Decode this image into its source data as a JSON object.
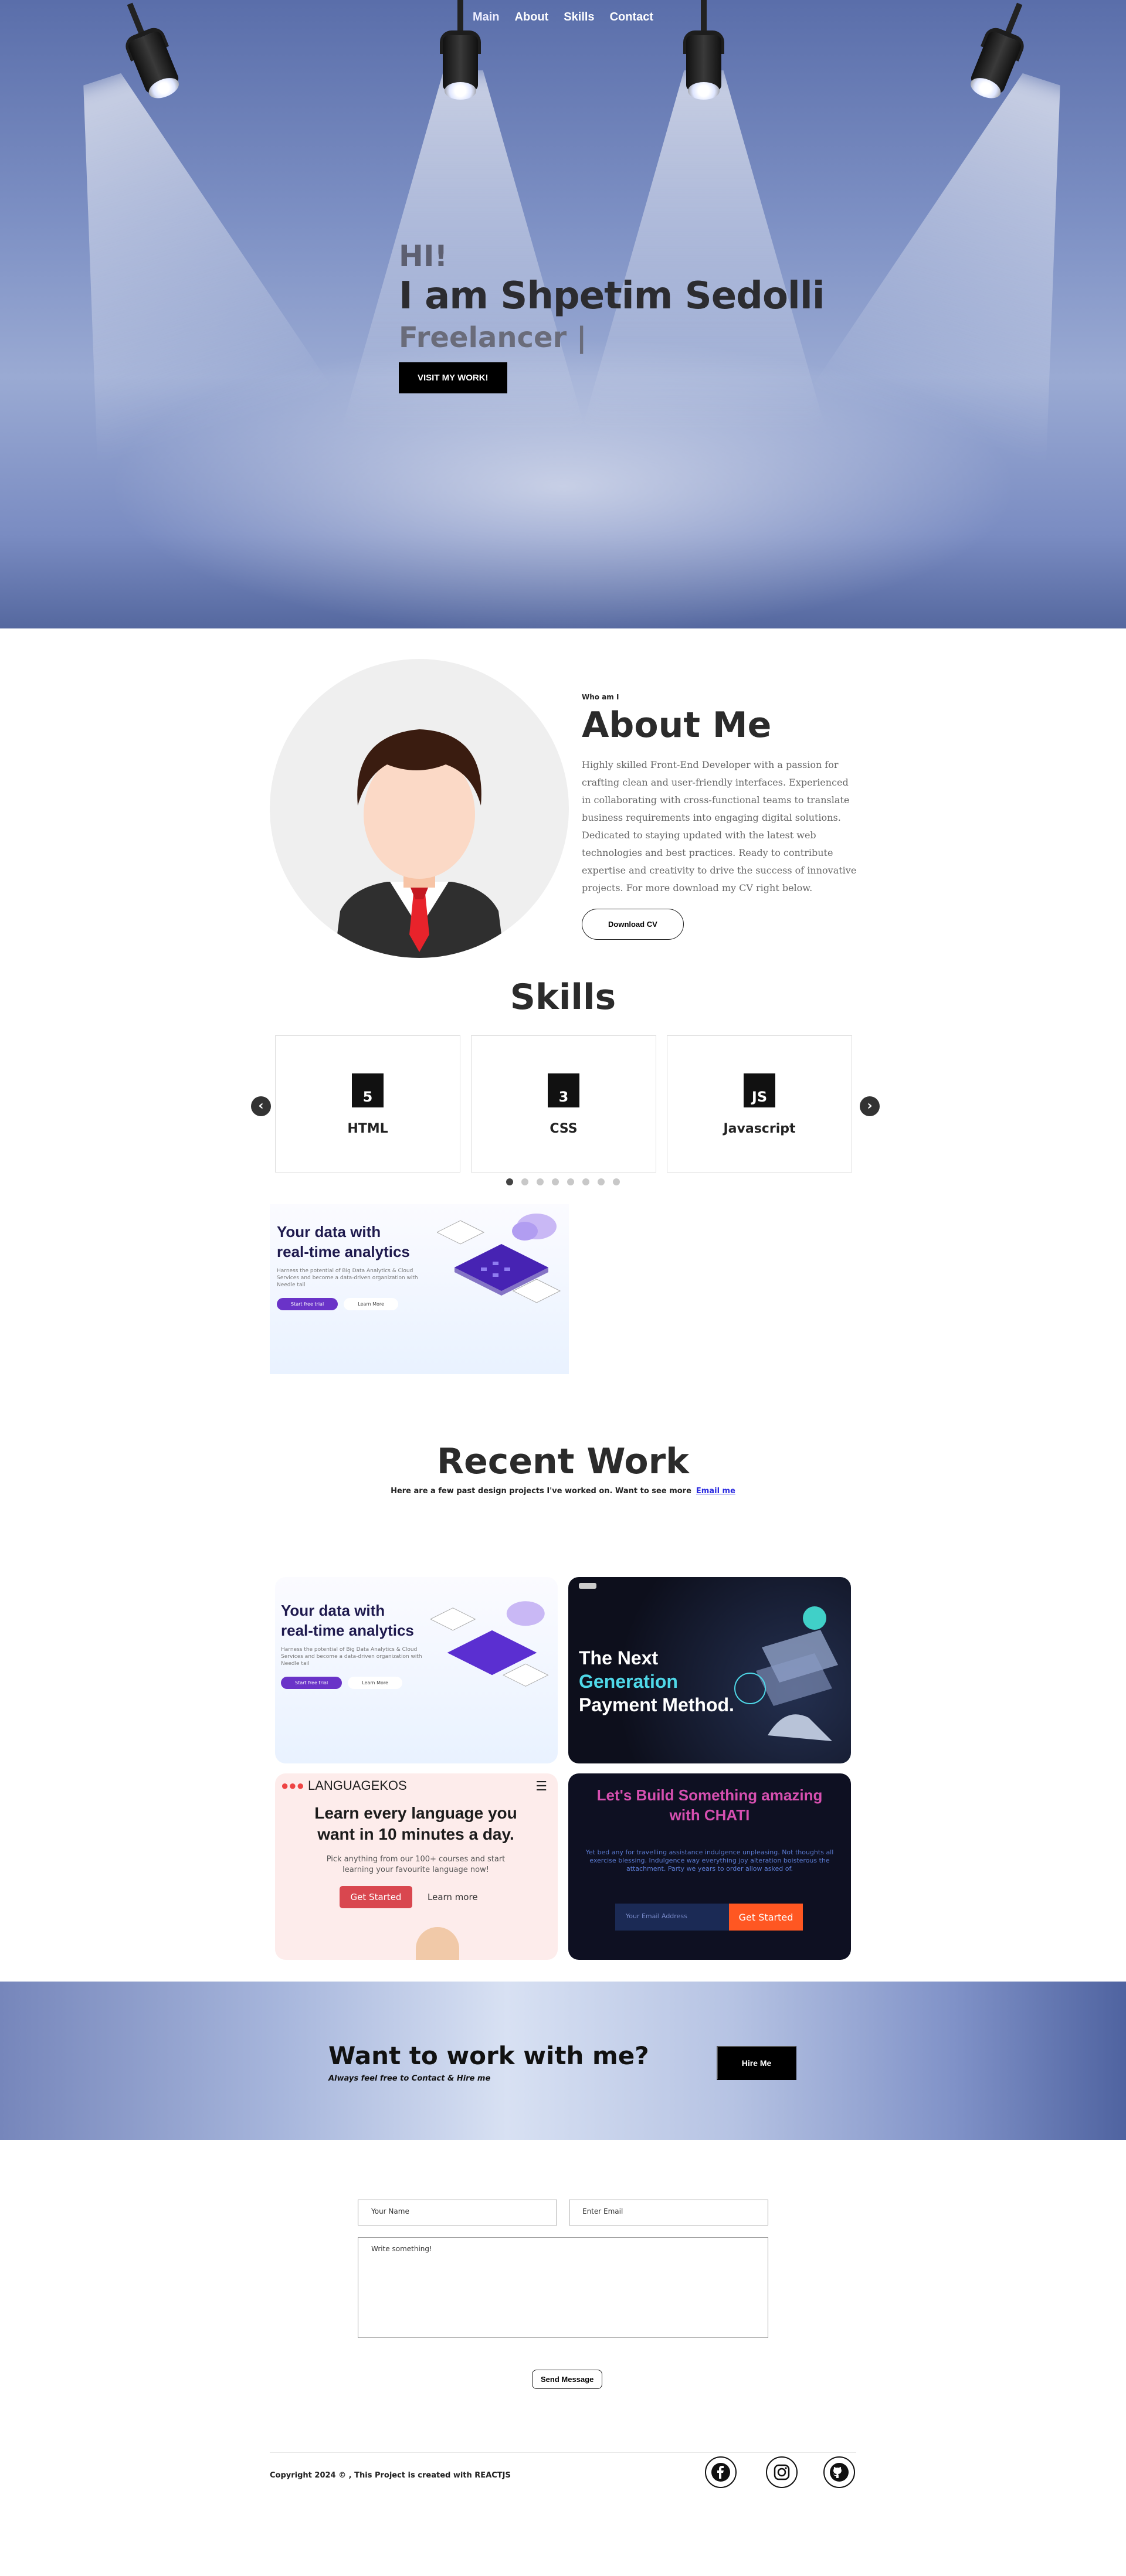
{
  "nav": {
    "items": [
      "Main",
      "About",
      "Skills",
      "Contact"
    ]
  },
  "hero": {
    "greeting": "HI!",
    "name": "I am Shpetim Sedolli",
    "role": "Freelancer |",
    "cta": "VISIT MY WORK!"
  },
  "about": {
    "eyebrow": "Who am I",
    "title": "About Me",
    "paragraph": "Highly skilled Front-End Developer with a passion for crafting clean and user-friendly interfaces. Experienced in collaborating with cross-functional teams to translate business requirements into engaging digital solutions. Dedicated to staying updated with the latest web technologies and best practices. Ready to contribute expertise and creativity to drive the success of innovative projects. For more download my CV right below.",
    "button": "Download CV"
  },
  "skills": {
    "title": "Skills",
    "items": [
      {
        "label": "HTML",
        "icon": "html5-icon",
        "glyph": "5"
      },
      {
        "label": "CSS",
        "icon": "css3-icon",
        "glyph": "3"
      },
      {
        "label": "Javascript",
        "icon": "js-icon",
        "glyph": "JS"
      }
    ],
    "dots": 8,
    "active_dot": 0
  },
  "analytics": {
    "title_line1": "Your data with",
    "title_line2": "real-time analytics",
    "desc": "Harness the potential of Big Data Analytics & Cloud Services and become a data-driven organization with Needle tail",
    "btn_primary": "Start free trial",
    "btn_secondary": "Learn More"
  },
  "recent": {
    "title": "Recent Work",
    "subtitle": "Here are a few past design projects I've worked on. Want to see more",
    "email_link": "Email me"
  },
  "payment": {
    "title_line1": "The Next",
    "title_line2": "Generation",
    "title_line3": "Payment Method."
  },
  "language": {
    "brand": "LANGUAGEKOS",
    "headline": "Learn every language you want in 10 minutes a day.",
    "text": "Pick anything from our 100+ courses and start learning your favourite language now!",
    "btn_primary": "Get Started",
    "btn_secondary": "Learn more"
  },
  "chat": {
    "headline": "Let's Build Something amazing with CHATI",
    "text": "Yet bed any for travelling assistance indulgence unpleasing. Not thoughts all exercise blessing. Indulgence way everything joy alteration boisterous the attachment. Party we years to order allow asked of.",
    "input_placeholder": "Your Email Address",
    "btn": "Get Started"
  },
  "cta": {
    "title": "Want to work with me?",
    "subtitle": "Always feel free to Contact & Hire me",
    "button": "Hire Me"
  },
  "contact": {
    "name_placeholder": "Your Name",
    "email_placeholder": "Enter Email",
    "message_placeholder": "Write something!",
    "send": "Send Message"
  },
  "footer": {
    "copyright": "Copyright 2024 © , This Project is created with REACTJS",
    "social": [
      "facebook-icon",
      "instagram-icon",
      "github-icon"
    ]
  },
  "colors": {
    "hero_blue": "#7d90c4",
    "accent_purple": "#6a33c8",
    "chat_pink": "#d64fb0",
    "cta_orange": "#ff5722"
  }
}
